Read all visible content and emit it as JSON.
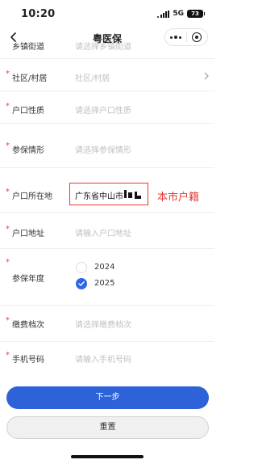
{
  "status_bar": {
    "time": "10:20",
    "network": "5G",
    "battery": "73"
  },
  "nav": {
    "title": "粤医保"
  },
  "form": {
    "partial_row": {
      "label": "乡镇街道",
      "placeholder": "请选择乡镇街道"
    },
    "rows": [
      {
        "label": "社区/村居",
        "value": "社区/村居",
        "required": true,
        "has_chevron": true,
        "filled": false
      },
      {
        "label": "户口性质",
        "value": "请选择户口性质",
        "required": true,
        "has_chevron": false,
        "filled": false
      },
      {
        "label": "参保情形",
        "value": "请选择参保情形",
        "required": true,
        "has_chevron": false,
        "filled": false
      },
      {
        "label": "户口所在地",
        "value": "广东省中山市",
        "required": true,
        "has_chevron": false,
        "filled": true
      },
      {
        "label": "户口地址",
        "value": "请输入户口地址",
        "required": true,
        "has_chevron": false,
        "filled": false
      },
      {
        "label": "参保年度",
        "required": true
      },
      {
        "label": "缴费档次",
        "value": "请选择缴费档次",
        "required": true,
        "has_chevron": false,
        "filled": false
      },
      {
        "label": "手机号码",
        "value": "请输入手机号码",
        "required": true,
        "has_chevron": false,
        "filled": false
      }
    ],
    "years": [
      {
        "year": "2024",
        "selected": false
      },
      {
        "year": "2025",
        "selected": true
      }
    ]
  },
  "annotation": {
    "text": "本市户籍",
    "color": "#e53935"
  },
  "buttons": {
    "next": "下一步",
    "reset": "重置"
  },
  "colors": {
    "primary": "#2e62d8",
    "required": "#e64340",
    "placeholder": "#c0c0c0"
  },
  "icons": [
    "back-icon",
    "more-icon",
    "target-icon",
    "chevron-right-icon",
    "check-icon"
  ]
}
